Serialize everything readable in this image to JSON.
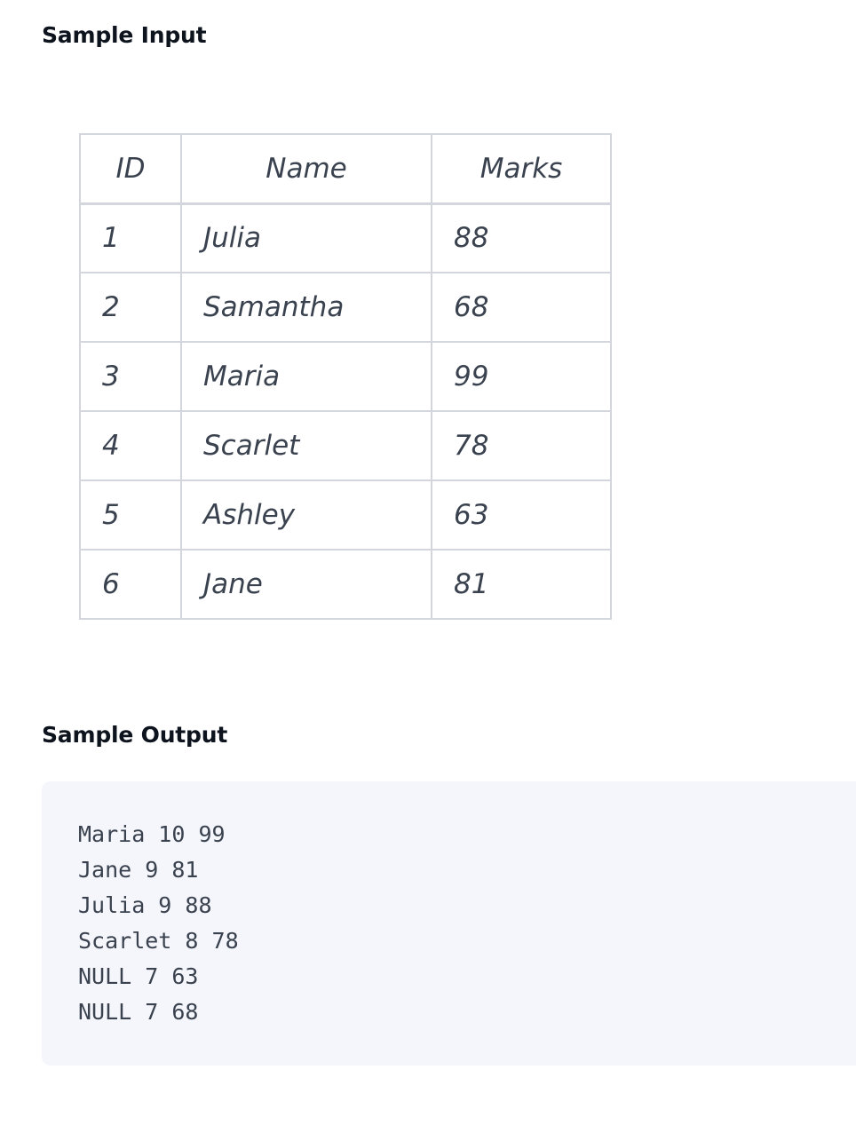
{
  "sample_input": {
    "heading": "Sample Input",
    "table": {
      "headers": [
        "ID",
        "Name",
        "Marks"
      ],
      "rows": [
        [
          "1",
          "Julia",
          "88"
        ],
        [
          "2",
          "Samantha",
          "68"
        ],
        [
          "3",
          "Maria",
          "99"
        ],
        [
          "4",
          "Scarlet",
          "78"
        ],
        [
          "5",
          "Ashley",
          "63"
        ],
        [
          "6",
          "Jane",
          "81"
        ]
      ]
    }
  },
  "sample_output": {
    "heading": "Sample Output",
    "lines": [
      "Maria 10 99",
      "Jane 9 81",
      "Julia 9 88",
      "Scarlet 8 78",
      "NULL 7 63",
      "NULL 7 68"
    ]
  }
}
